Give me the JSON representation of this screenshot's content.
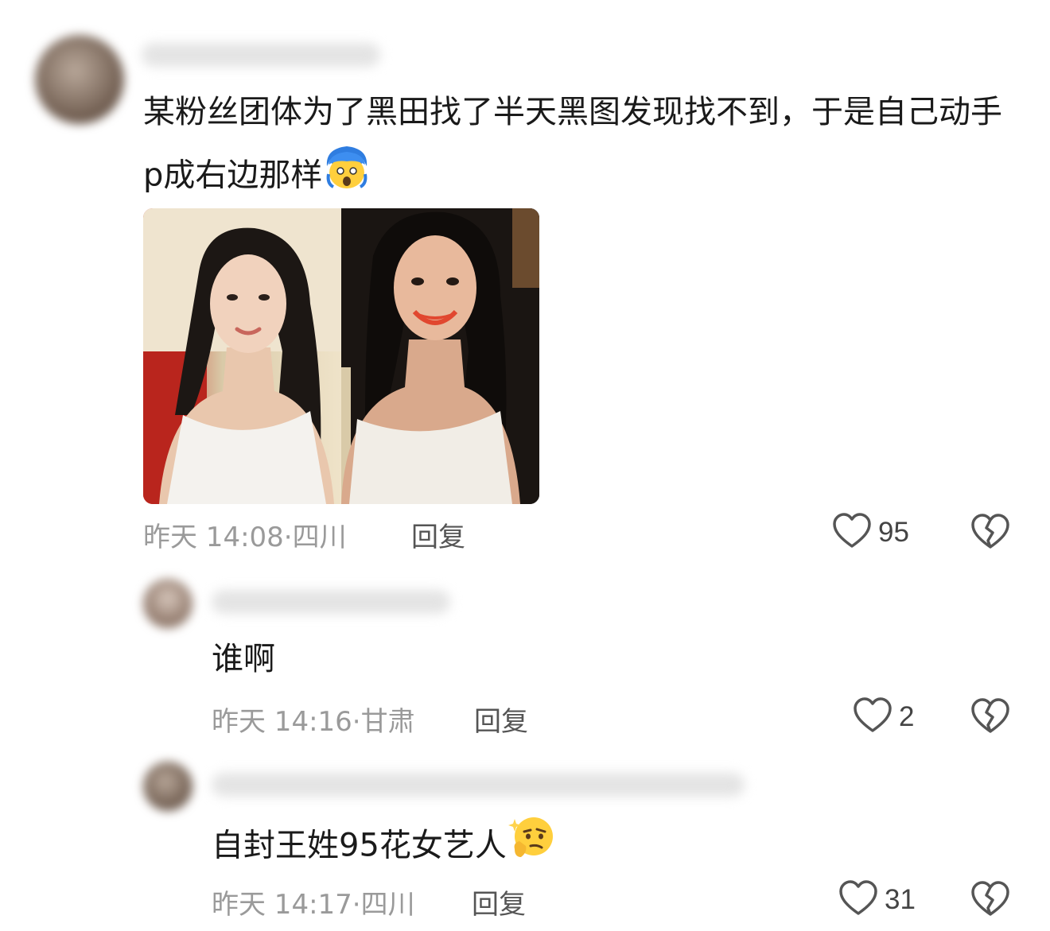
{
  "comments": [
    {
      "text": "某粉丝团体为了黑田找了半天黑图发现找不到，于是自己动手p成右边那样",
      "emoji": "scream-blue-hair-emoji",
      "time": "昨天 14:08",
      "location": "四川",
      "reply_label": "回复",
      "likes": "95"
    },
    {
      "text": "谁啊",
      "time": "昨天 14:16",
      "location": "甘肃",
      "reply_label": "回复",
      "likes": "2"
    },
    {
      "text": "自封王姓95花女艺人",
      "emoji": "thinking-face-emoji",
      "time": "昨天 14:17",
      "location": "四川",
      "reply_label": "回复",
      "likes": "31"
    }
  ],
  "colors": {
    "meta_text": "#9a9a9a",
    "body_text": "#1a1a1a",
    "icon_stroke": "#555555"
  },
  "icons": [
    "heart-outline-icon",
    "broken-heart-icon"
  ]
}
